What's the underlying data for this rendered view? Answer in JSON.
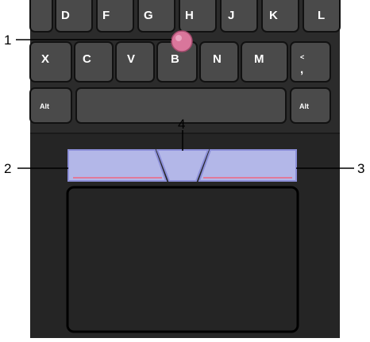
{
  "keyboard": {
    "row1_keys": [
      "D",
      "F",
      "G",
      "H",
      "J",
      "K",
      "L"
    ],
    "row2_keys": [
      "X",
      "C",
      "V",
      "B",
      "N",
      "M",
      "<"
    ],
    "row2_comma": ",",
    "row3": {
      "left_alt": "Alt",
      "right_alt": "Alt"
    }
  },
  "callouts": {
    "c1": "1",
    "c2": "2",
    "c3": "3",
    "c4": "4"
  },
  "colors": {
    "keyboard_bg": "#2b2b2b",
    "key_fill": "#4a4a4a",
    "key_stroke": "#111111",
    "trackpoint": "#d9769b",
    "button_fill": "#b3b7e8",
    "button_stroke": "#8c8fd8",
    "button_accent": "#e07a9a"
  }
}
